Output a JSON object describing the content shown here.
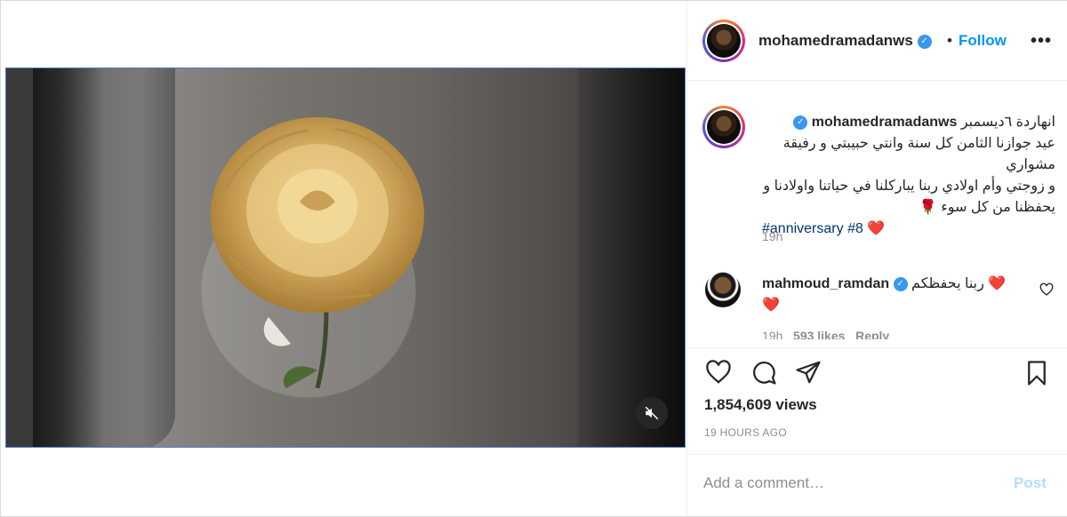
{
  "post": {
    "username": "mohamedramadanws",
    "verified_icon": "verified-badge-icon",
    "follow_label": "Follow",
    "separator": "•",
    "more_label": "•••"
  },
  "caption": {
    "username": "mohamedramadanws",
    "text_line1": "انهاردة ٦ديسمبر",
    "text_line2": "عيد جوازنا الثامن كل سنة وانتي حبيبتي و رفيقة مشواري",
    "text_line3": "و زوجتي وأم اولادي ربنا يباركلنا في حياتنا واولادنا و",
    "text_line4": "يحفظنا من كل سوء",
    "rose_emoji": "🌹",
    "hashtag": "#anniversary",
    "hashtag_suffix": "#8",
    "heart": "❤️",
    "time": "19h"
  },
  "comment": {
    "username": "mahmoud_ramdan",
    "text": "ربنا يحفظكم",
    "heart": "❤️",
    "heart2": "❤️",
    "time": "19h",
    "likes": "593 likes",
    "reply": "Reply"
  },
  "stats": {
    "views": "1,854,609 views",
    "ago": "19 HOURS AGO"
  },
  "add_comment": {
    "placeholder": "Add a comment…",
    "post_label": "Post"
  },
  "colors": {
    "accent": "#0095f6",
    "post_disabled": "#b2dffc",
    "heart": "#ed4956"
  }
}
